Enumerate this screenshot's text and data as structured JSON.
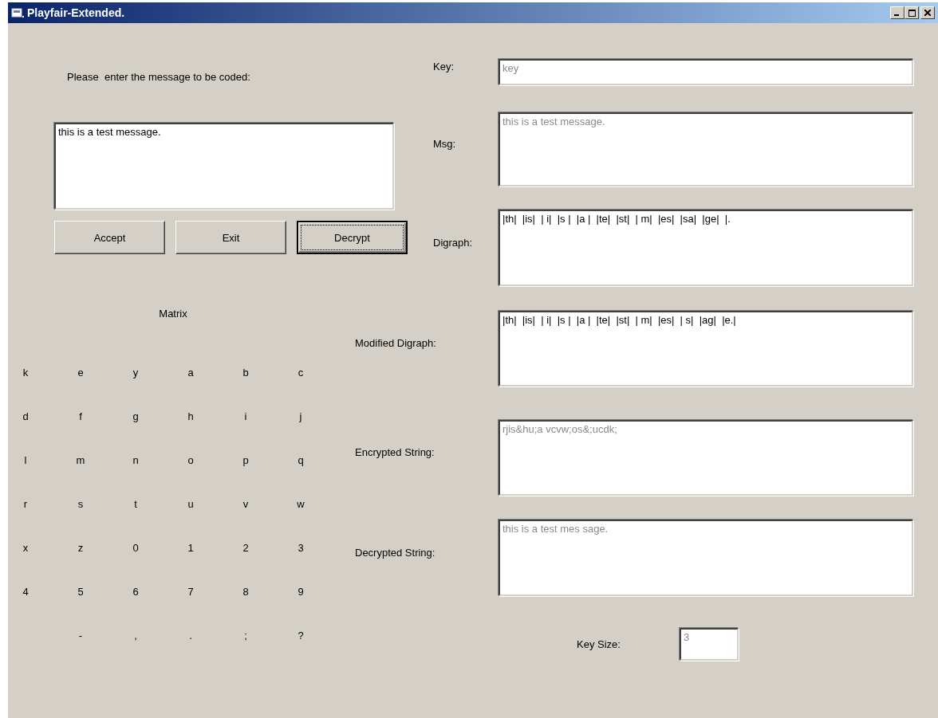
{
  "window": {
    "title": "Playfair-Extended."
  },
  "prompt": "Please  enter the message to be coded:",
  "message_input": {
    "value": "this is a test message."
  },
  "buttons": [
    {
      "label": "Accept",
      "focused": false
    },
    {
      "label": "Exit",
      "focused": false
    },
    {
      "label": "Decrypt",
      "focused": true
    }
  ],
  "matrix": {
    "title": "Matrix",
    "rows": [
      [
        "k",
        "e",
        "y",
        "a",
        "b",
        "c"
      ],
      [
        "d",
        "f",
        "g",
        "h",
        "i",
        "j"
      ],
      [
        "l",
        "m",
        "n",
        "o",
        "p",
        "q"
      ],
      [
        "r",
        "s",
        "t",
        "u",
        "v",
        "w"
      ],
      [
        "x",
        "z",
        "0",
        "1",
        "2",
        "3"
      ],
      [
        "4",
        "5",
        "6",
        "7",
        "8",
        "9"
      ],
      [
        null,
        "-",
        ",",
        ".",
        ";",
        "?"
      ]
    ]
  },
  "fields": [
    {
      "label": "Key:",
      "value": "key",
      "disabled": true
    },
    {
      "label": "Msg:",
      "value": "this is a test message.",
      "disabled": true
    },
    {
      "label": "Digraph:",
      "value": "|th|  |is|  | i|  |s |  |a |  |te|  |st|  | m|  |es|  |sa|  |ge|  |.",
      "disabled": false
    },
    {
      "label": "Modified Digraph:",
      "value": "|th|  |is|  | i|  |s |  |a |  |te|  |st|  | m|  |es|  | s|  |ag|  |e.|",
      "disabled": false
    },
    {
      "label": "Encrypted String:",
      "value": "rjis&hu;a vcvw;os&;ucdk;",
      "disabled": true
    },
    {
      "label": "Decrypted String:",
      "value": "this is a test mes sage.",
      "disabled": true
    }
  ],
  "key_size": {
    "label": "Key Size:",
    "value": "3",
    "disabled": true
  }
}
